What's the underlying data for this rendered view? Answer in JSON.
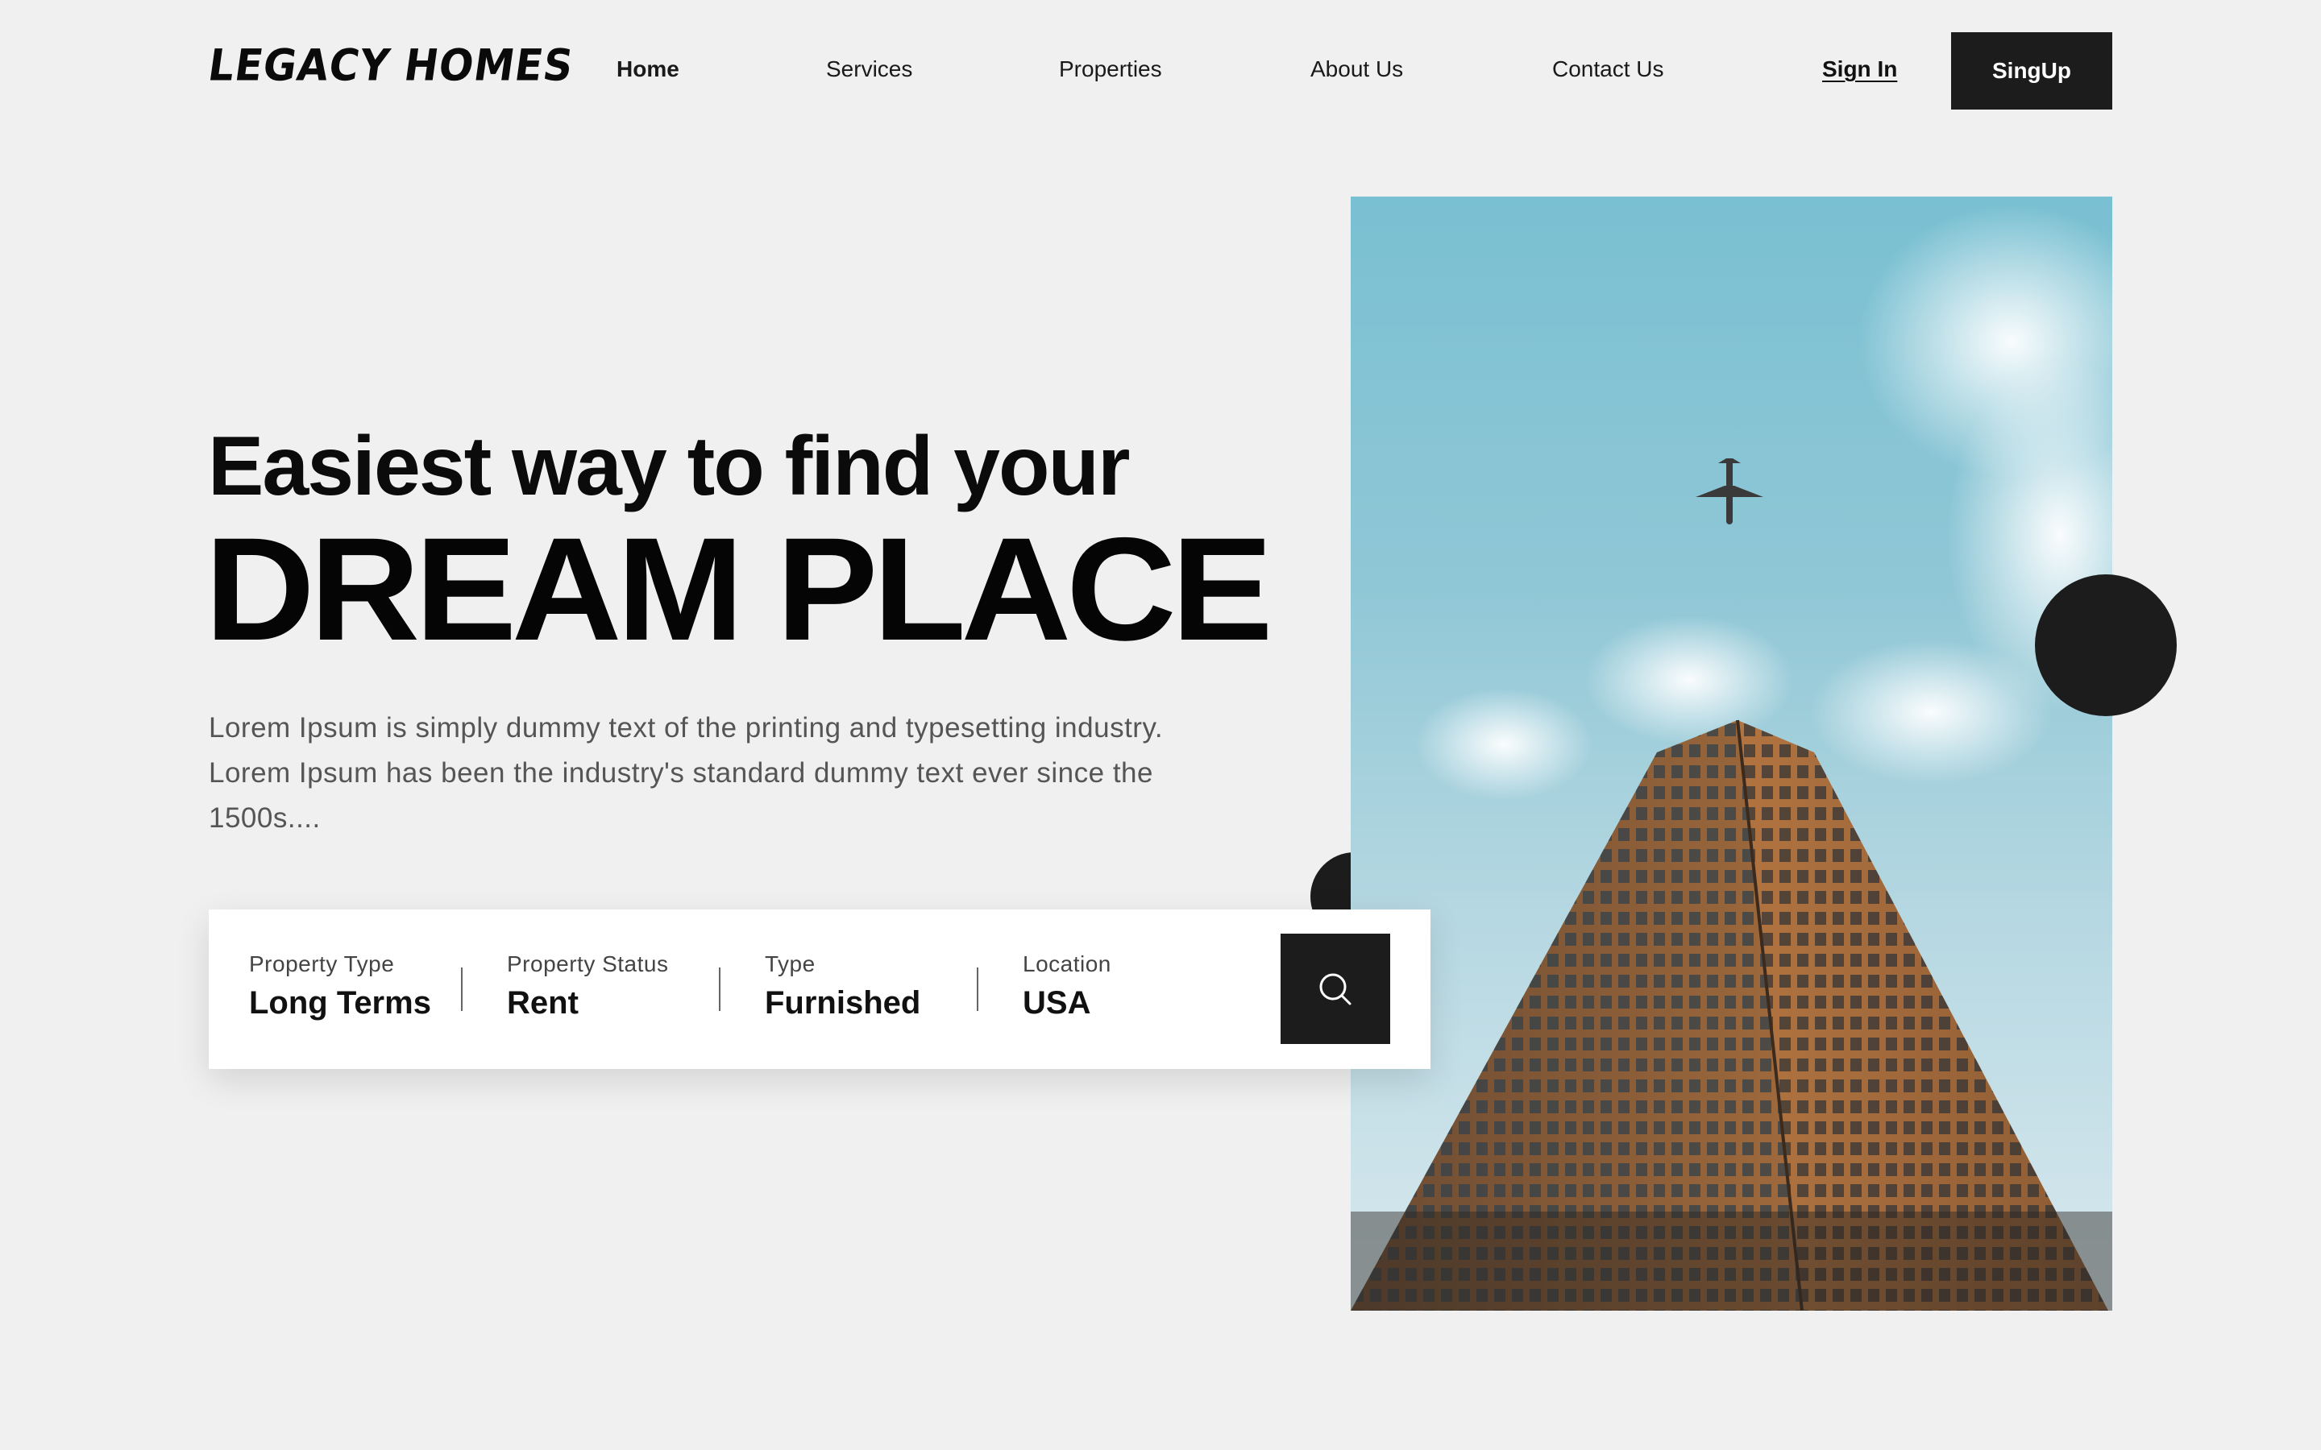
{
  "brand": {
    "logo_text": "LEGACY HOMES"
  },
  "nav": {
    "links": [
      {
        "label": "Home",
        "active": true
      },
      {
        "label": "Services"
      },
      {
        "label": "Properties"
      },
      {
        "label": "About Us"
      },
      {
        "label": "Contact Us"
      }
    ],
    "sign_in_label": "Sign In",
    "signup_label": "SingUp"
  },
  "hero": {
    "subtitle": "Easiest way to find your",
    "title": "DREAM PLACE",
    "description": "Lorem Ipsum is simply dummy text of the printing and typesetting industry. Lorem Ipsum has been the industry's standard dummy text ever since the 1500s...."
  },
  "search": {
    "fields": [
      {
        "label": "Property Type",
        "value": "Long Terms"
      },
      {
        "label": "Property Status",
        "value": "Rent"
      },
      {
        "label": "Type",
        "value": "Furnished"
      },
      {
        "label": "Location",
        "value": "USA"
      }
    ],
    "button_icon": "search-icon"
  },
  "image": {
    "subject": "skyscraper-with-airplane-photo"
  },
  "colors": {
    "background": "#f0f0f0",
    "dark": "#1c1c1c",
    "text": "#111111",
    "muted": "#555555"
  }
}
